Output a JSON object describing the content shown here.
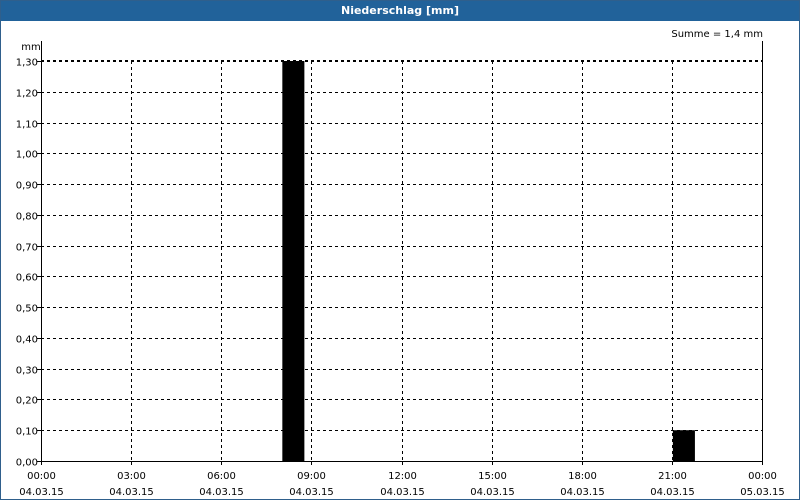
{
  "window": {
    "title": "Niederschlag [mm]"
  },
  "summary": "Summe = 1,4 mm",
  "chart_data": {
    "type": "bar",
    "title": "Niederschlag [mm]",
    "ylabel": "mm",
    "ylim": [
      0,
      1.3
    ],
    "yticks": [
      0,
      0.1,
      0.2,
      0.3,
      0.4,
      0.5,
      0.6,
      0.7,
      0.8,
      0.9,
      1.0,
      1.1,
      1.2,
      1.3
    ],
    "ytick_labels": [
      "0,00",
      "0,10",
      "0,20",
      "0,30",
      "0,40",
      "0,50",
      "0,60",
      "0,70",
      "0,80",
      "0,90",
      "1,00",
      "1,10",
      "1,20",
      "1,30"
    ],
    "x_ticks": [
      {
        "time": "00:00",
        "date": "04.03.15",
        "hour": 0
      },
      {
        "time": "03:00",
        "date": "04.03.15",
        "hour": 3
      },
      {
        "time": "06:00",
        "date": "04.03.15",
        "hour": 6
      },
      {
        "time": "09:00",
        "date": "04.03.15",
        "hour": 9
      },
      {
        "time": "12:00",
        "date": "04.03.15",
        "hour": 12
      },
      {
        "time": "15:00",
        "date": "04.03.15",
        "hour": 15
      },
      {
        "time": "18:00",
        "date": "04.03.15",
        "hour": 18
      },
      {
        "time": "21:00",
        "date": "04.03.15",
        "hour": 21
      },
      {
        "time": "00:00",
        "date": "05.03.15",
        "hour": 24
      }
    ],
    "xlim_hours": [
      0,
      24
    ],
    "bars": [
      {
        "hour_start": 8,
        "hour_end": 9,
        "value": 1.3
      },
      {
        "hour_start": 21,
        "hour_end": 22,
        "value": 0.1
      }
    ],
    "grid": true,
    "colors": {
      "bar": "#000000",
      "grid": "#000000",
      "title_bar": "#21629a"
    }
  }
}
